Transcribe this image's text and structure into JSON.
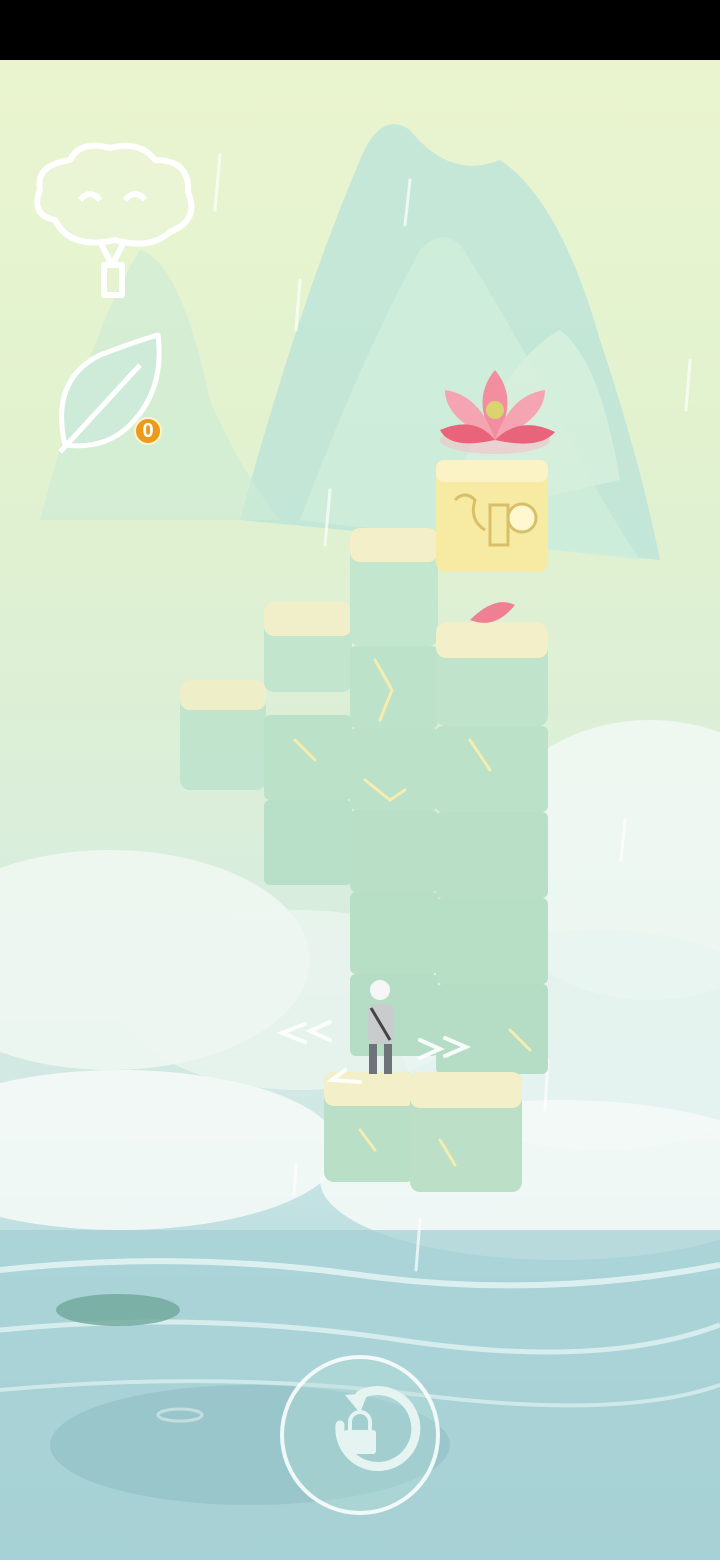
{
  "hud": {
    "hint_icon": "cloud-tree-icon",
    "leaf_icon": "leaf-icon",
    "leaf_count": "0"
  },
  "controls": {
    "restart_icon": "restart-locked-icon"
  },
  "colors": {
    "sky_top": "#eaf5cf",
    "water": "#a9d2d6",
    "block": "#bfe3cc",
    "block_top": "#f3efc8",
    "goal_block": "#f7eaa3",
    "lotus": "#e9647a",
    "badge": "#ec9a1b"
  }
}
